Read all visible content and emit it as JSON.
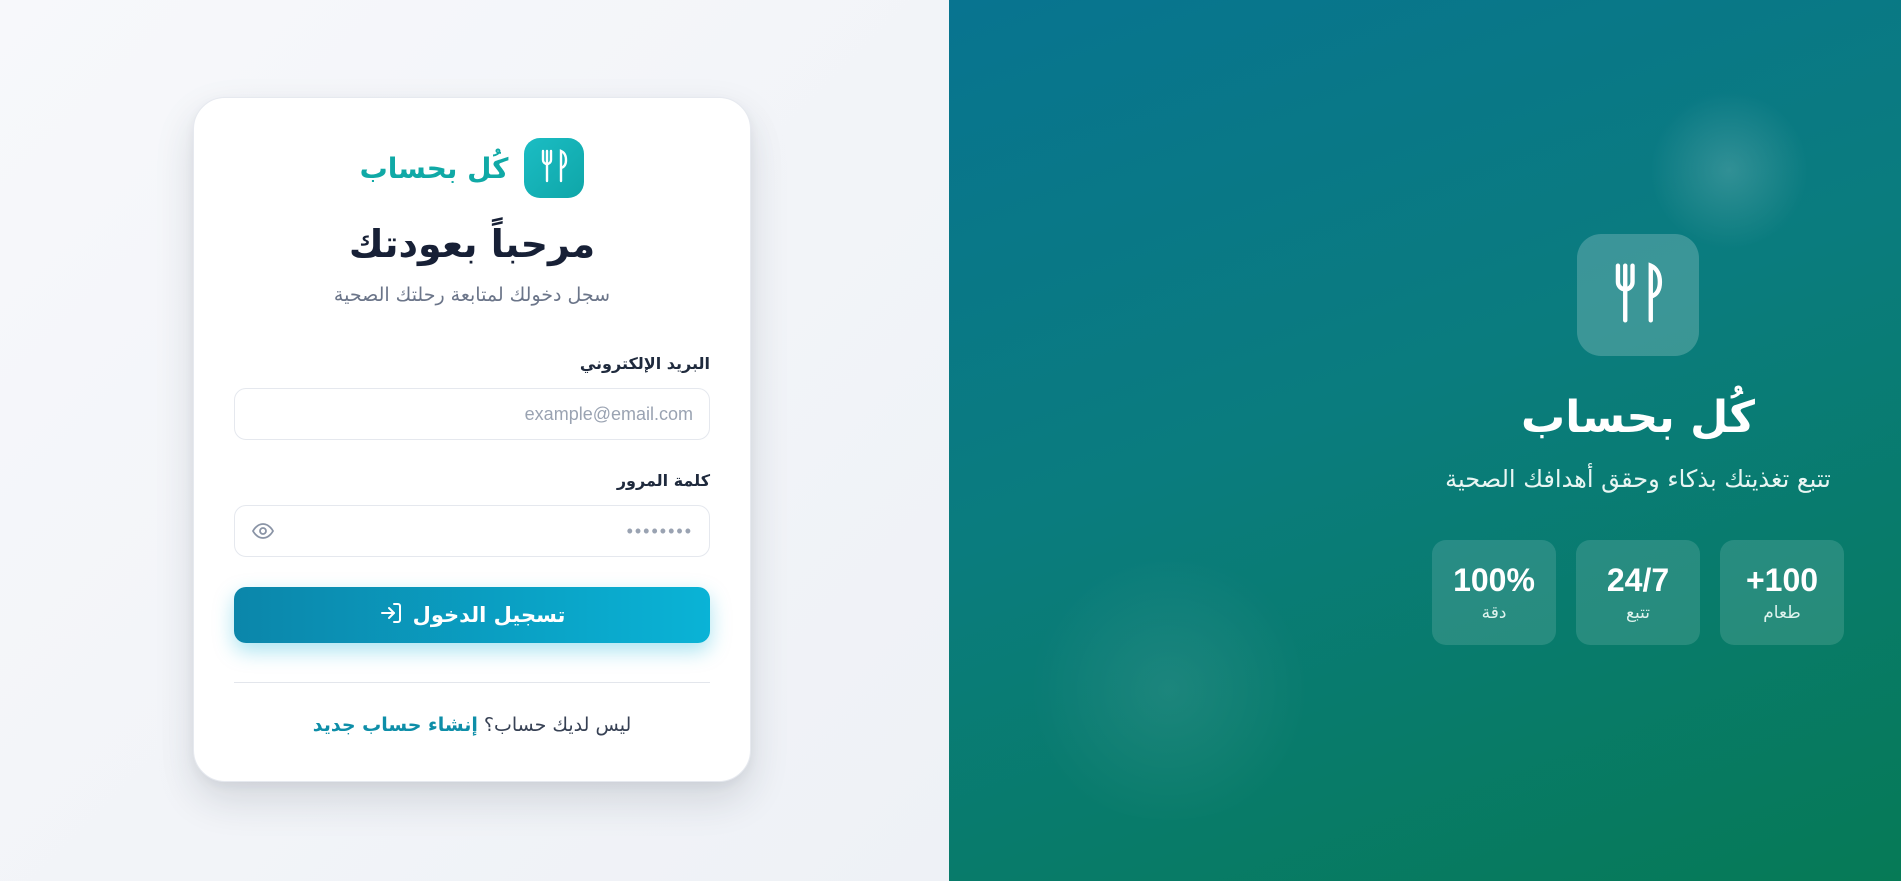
{
  "brand": {
    "name": "كُل بحساب",
    "icon": "utensils-icon",
    "accent_color": "#10a9a6"
  },
  "login": {
    "title": "مرحباً بعودتك",
    "subtitle": "سجل دخولك لمتابعة رحلتك الصحية",
    "email_label": "البريد الإلكتروني",
    "email_placeholder": "example@email.com",
    "password_label": "كلمة المرور",
    "password_mask": "••••••••",
    "submit_label": "تسجيل الدخول",
    "submit_icon": "login-arrow-icon",
    "no_account_text": "ليس لديك حساب؟",
    "signup_link": "إنشاء حساب جديد"
  },
  "hero": {
    "title": "كُل بحساب",
    "tagline": "تتبع تغذيتك بذكاء وحقق أهدافك الصحية",
    "stats": [
      {
        "value": "100%",
        "label": "دقة"
      },
      {
        "value": "24/7",
        "label": "تتبع"
      },
      {
        "value": "+100",
        "label": "طعام"
      }
    ]
  }
}
